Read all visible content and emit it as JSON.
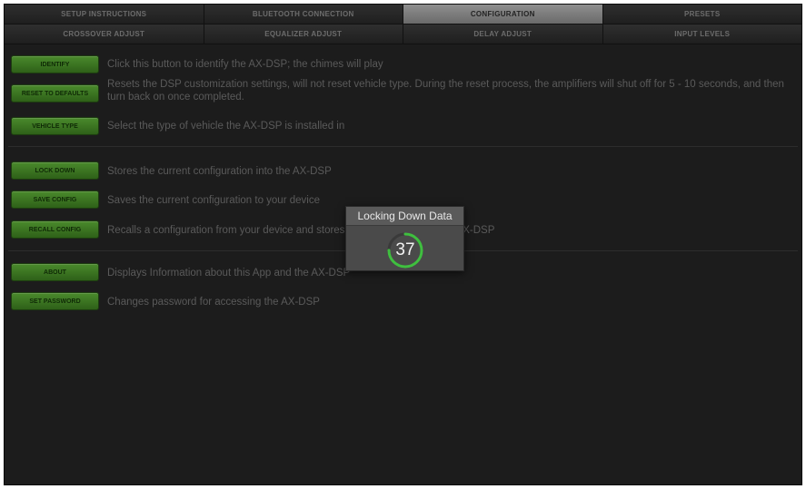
{
  "tabs_top": [
    {
      "label": "SETUP INSTRUCTIONS",
      "active": false
    },
    {
      "label": "BLUETOOTH CONNECTION",
      "active": false
    },
    {
      "label": "CONFIGURATION",
      "active": true
    },
    {
      "label": "PRESETS",
      "active": false
    }
  ],
  "tabs_bottom": [
    {
      "label": "CROSSOVER ADJUST",
      "active": false
    },
    {
      "label": "EQUALIZER ADJUST",
      "active": false
    },
    {
      "label": "DELAY ADJUST",
      "active": false
    },
    {
      "label": "INPUT LEVELS",
      "active": false
    }
  ],
  "actions": [
    {
      "button": "IDENTIFY",
      "description": "Click this button to identify the AX-DSP; the chimes will play"
    },
    {
      "button": "RESET TO DEFAULTS",
      "description": "Resets the DSP customization settings, will not reset vehicle type. During the reset process, the amplifiers will shut off for 5 - 10 seconds, and then turn back on once completed."
    },
    {
      "button": "VEHICLE TYPE",
      "description": "Select the type of vehicle the AX-DSP is installed in"
    },
    {
      "button": "LOCK DOWN",
      "description": "Stores the current configuration into the AX-DSP"
    },
    {
      "button": "SAVE CONFIG",
      "description": "Saves the current configuration to your device"
    },
    {
      "button": "RECALL CONFIG",
      "description": "Recalls a configuration from your device and stores the configuration in the AX-DSP"
    },
    {
      "button": "ABOUT",
      "description": "Displays Information about this App and the AX-DSP"
    },
    {
      "button": "SET PASSWORD",
      "description": "Changes password for accessing the AX-DSP"
    }
  ],
  "dialog": {
    "title": "Locking Down Data",
    "count": "37",
    "progress": 0.75
  },
  "colors": {
    "button_green": "#3e7a24",
    "spinner_green": "#3fbf3f",
    "background": "#1c1c1c"
  }
}
